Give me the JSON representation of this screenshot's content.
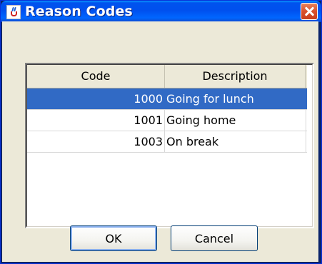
{
  "window": {
    "title": "Reason Codes",
    "icon": "java-cup-icon",
    "close_icon": "close-icon"
  },
  "table": {
    "columns": [
      "Code",
      "Description"
    ],
    "rows": [
      {
        "code": "1000",
        "description": "Going for lunch",
        "selected": true
      },
      {
        "code": "1001",
        "description": "Going home",
        "selected": false
      },
      {
        "code": "1003",
        "description": "On break",
        "selected": false
      }
    ]
  },
  "buttons": {
    "ok_label": "OK",
    "cancel_label": "Cancel"
  },
  "colors": {
    "titlebar": "#0053ee",
    "selection": "#316ac5",
    "dialog_bg": "#ece9d8",
    "close_button": "#d9502c"
  }
}
